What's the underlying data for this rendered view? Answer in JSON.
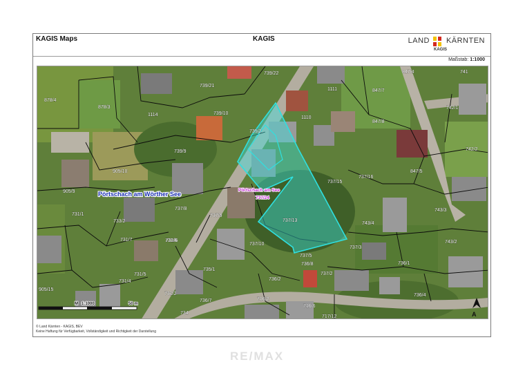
{
  "header": {
    "app_name": "KAGIS Maps",
    "system_title": "KAGIS",
    "logo": {
      "left_word": "LAND",
      "right_word": "KÄRNTEN",
      "sub": "KAGIS",
      "emblem_colors": [
        "#f2c200",
        "#d32a1f"
      ]
    }
  },
  "scale": {
    "label": "Maßstab:",
    "value": "1:1000"
  },
  "map": {
    "place_label": "Pörtschach am Wörther See",
    "address_label": "Pörtschach am See",
    "address_number": "737/24",
    "highlight_color": "#38e5e5",
    "parcels": [
      "878/4",
      "878/3",
      "739/21",
      "739/22",
      "847/4",
      "741",
      "1111",
      "847/7",
      "742/1",
      "1114",
      "739/10",
      "1110",
      "735/2",
      "739/9",
      "847/8",
      "742/2",
      "905/10",
      "847/5",
      "905/9",
      "737/15",
      "737/16",
      "737/8",
      "743/3",
      "731/1",
      "733/2",
      "737/9",
      "737/13",
      "743/4",
      "731/7",
      "731/6",
      "737/10",
      "743/2",
      "731/6",
      "737/5",
      "737/3",
      "736/8",
      "736/1",
      "731/5",
      "735/1",
      "737/2",
      "731/4",
      "905/15",
      "736/2",
      "736/4",
      "731/2",
      "736/7",
      "716/2",
      "734",
      "716/6",
      "717/12"
    ],
    "scalebar": {
      "left": "M",
      "mid": "1:1000",
      "right": "50 m"
    },
    "north_arrow": "A"
  },
  "footer": {
    "line1": "© Land Kärnten - KAGIS, BEV",
    "line2": "Keine Haftung für Verfügbarkeit, Vollständigkeit und Richtigkeit der Darstellung"
  },
  "watermark": "RE/MAX"
}
